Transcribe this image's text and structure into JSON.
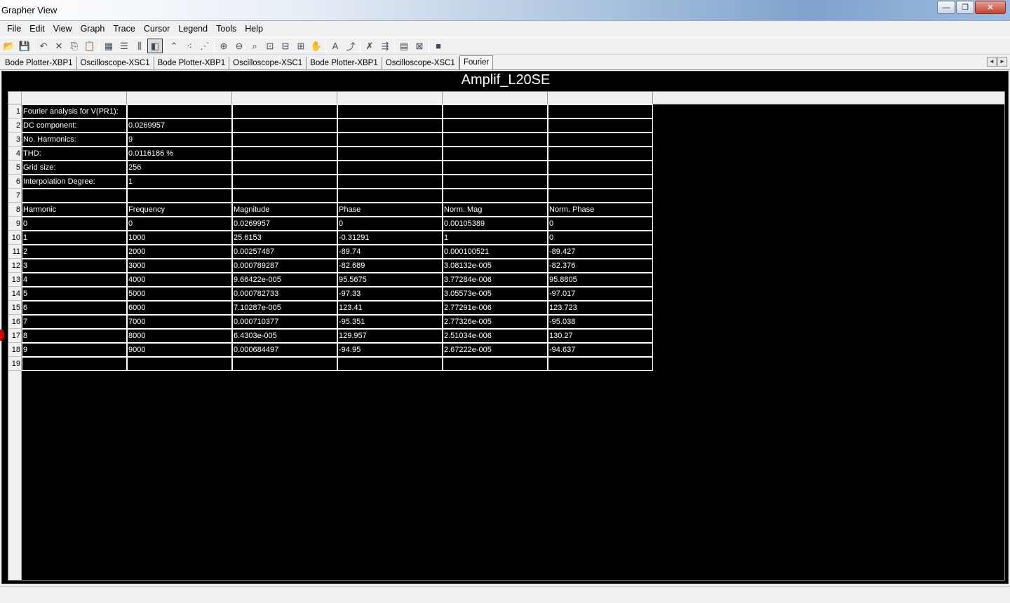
{
  "window": {
    "title": "Grapher View",
    "buttons": {
      "minimize": "—",
      "maximize": "❐",
      "close": "✕"
    }
  },
  "menu": [
    "File",
    "Edit",
    "View",
    "Graph",
    "Trace",
    "Cursor",
    "Legend",
    "Tools",
    "Help"
  ],
  "toolbar": [
    {
      "name": "open-icon",
      "glyph": "📂"
    },
    {
      "name": "save-icon",
      "glyph": "💾"
    },
    {
      "sep": true
    },
    {
      "name": "undo-icon",
      "glyph": "↶"
    },
    {
      "name": "delete-icon",
      "glyph": "✕"
    },
    {
      "name": "copy-icon",
      "glyph": "⎘"
    },
    {
      "name": "paste-icon",
      "glyph": "📋"
    },
    {
      "sep": true
    },
    {
      "name": "grid-icon",
      "glyph": "▦"
    },
    {
      "name": "list-icon",
      "glyph": "☰"
    },
    {
      "name": "chart-icon",
      "glyph": "⫼"
    },
    {
      "name": "reverse-colors-icon",
      "glyph": "◧",
      "active": true
    },
    {
      "sep": true
    },
    {
      "name": "cursor-trace-icon",
      "glyph": "⌃"
    },
    {
      "name": "points-icon",
      "glyph": "⁖"
    },
    {
      "name": "lines-points-icon",
      "glyph": "⋰"
    },
    {
      "sep": true
    },
    {
      "name": "zoom-in-icon",
      "glyph": "⊕"
    },
    {
      "name": "zoom-out-icon",
      "glyph": "⊖"
    },
    {
      "name": "zoom-full-icon",
      "glyph": "⌕"
    },
    {
      "name": "zoom-x-icon",
      "glyph": "⊡"
    },
    {
      "name": "zoom-y-icon",
      "glyph": "⊟"
    },
    {
      "name": "zoom-area-icon",
      "glyph": "⊞"
    },
    {
      "name": "pan-icon",
      "glyph": "✋"
    },
    {
      "sep": true
    },
    {
      "name": "text-icon",
      "glyph": "A"
    },
    {
      "name": "marker-icon",
      "glyph": "⤴"
    },
    {
      "sep": true
    },
    {
      "name": "overlay-icon",
      "glyph": "✗"
    },
    {
      "name": "export-icon",
      "glyph": "⇶"
    },
    {
      "sep": true
    },
    {
      "name": "properties-icon",
      "glyph": "▤"
    },
    {
      "name": "export-excel-icon",
      "glyph": "⊠"
    },
    {
      "sep": true
    },
    {
      "name": "stop-icon",
      "glyph": "■"
    }
  ],
  "tabs": [
    {
      "label": "Bode Plotter-XBP1"
    },
    {
      "label": "Oscilloscope-XSC1"
    },
    {
      "label": "Bode Plotter-XBP1"
    },
    {
      "label": "Oscilloscope-XSC1"
    },
    {
      "label": "Bode Plotter-XBP1"
    },
    {
      "label": "Oscilloscope-XSC1"
    },
    {
      "label": "Fourier",
      "active": true
    }
  ],
  "tab_scroll": {
    "left": "◄",
    "right": "►"
  },
  "graph": {
    "title": "Amplif_L20SE",
    "row_numbers": [
      "1",
      "2",
      "3",
      "4",
      "5",
      "6",
      "7",
      "8",
      "9",
      "10",
      "11",
      "12",
      "13",
      "14",
      "15",
      "16",
      "17",
      "18",
      "19"
    ],
    "rows": [
      [
        "Fourier analysis for V(PR1):",
        "",
        "",
        "",
        "",
        ""
      ],
      [
        "DC component:",
        "0.0269957",
        "",
        "",
        "",
        ""
      ],
      [
        "No. Harmonics:",
        "9",
        "",
        "",
        "",
        ""
      ],
      [
        "THD:",
        "0.0116186 %",
        "",
        "",
        "",
        ""
      ],
      [
        "Grid size:",
        "256",
        "",
        "",
        "",
        ""
      ],
      [
        "Interpolation Degree:",
        "1",
        "",
        "",
        "",
        ""
      ],
      [
        "",
        "",
        "",
        "",
        "",
        ""
      ],
      [
        "Harmonic",
        "Frequency",
        "Magnitude",
        "Phase",
        "Norm. Mag",
        "Norm. Phase"
      ],
      [
        "0",
        "0",
        "0.0269957",
        "0",
        "0.00105389",
        "0"
      ],
      [
        "1",
        "1000",
        "25.6153",
        "-0.31291",
        "1",
        "0"
      ],
      [
        "2",
        "2000",
        "0.00257487",
        "-89.74",
        "0.000100521",
        "-89.427"
      ],
      [
        "3",
        "3000",
        "0.000789287",
        "-82.689",
        "3.08132e-005",
        "-82.376"
      ],
      [
        "4",
        "4000",
        "9.66422e-005",
        "95.5675",
        "3.77284e-006",
        "95.8805"
      ],
      [
        "5",
        "5000",
        "0.000782733",
        "-97.33",
        "3.05573e-005",
        "-97.017"
      ],
      [
        "6",
        "6000",
        "7.10287e-005",
        "123.41",
        "2.77291e-006",
        "123.723"
      ],
      [
        "7",
        "7000",
        "0.000710377",
        "-95.351",
        "2.77326e-005",
        "-95.038"
      ],
      [
        "8",
        "8000",
        "6.4303e-005",
        "129.957",
        "2.51034e-006",
        "130.27"
      ],
      [
        "9",
        "9000",
        "0.000684497",
        "-94.95",
        "2.67222e-005",
        "-94.637"
      ],
      [
        "",
        "",
        "",
        "",
        "",
        ""
      ]
    ]
  }
}
